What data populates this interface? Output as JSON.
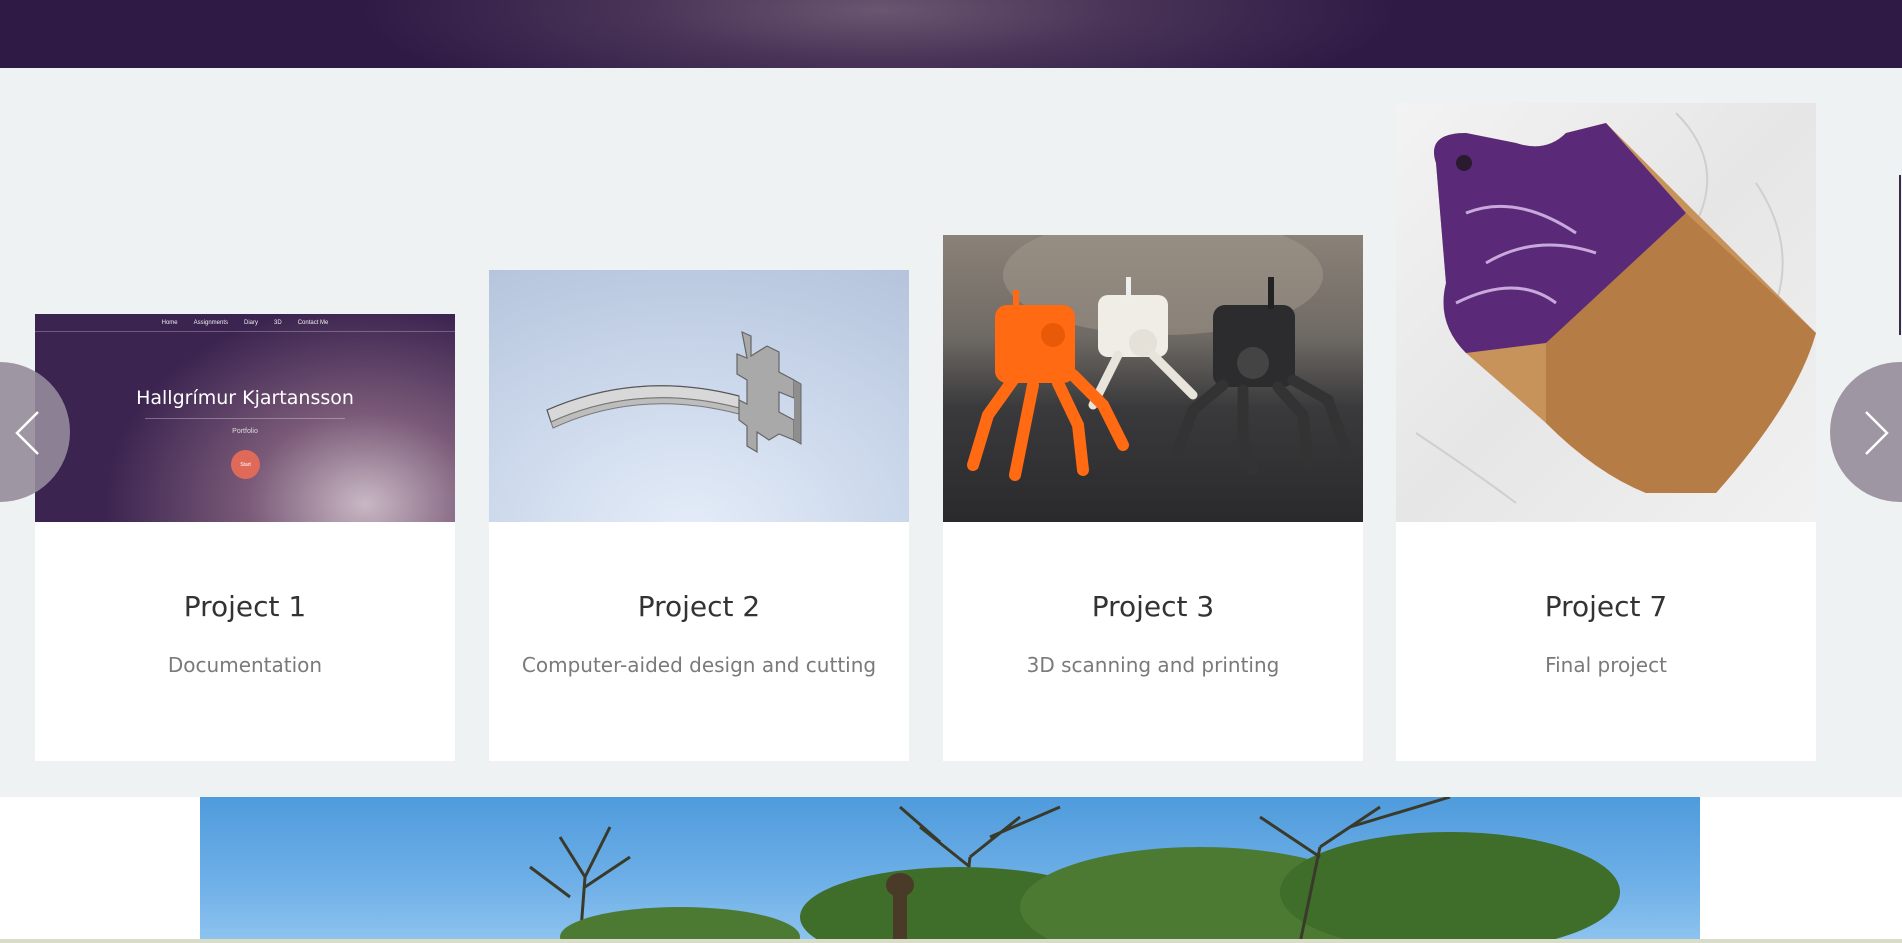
{
  "header": {
    "banner": "top-banner"
  },
  "slider": {
    "prev_icon": "chevron-left-icon",
    "next_icon": "chevron-right-icon",
    "cards": [
      {
        "title": "Project 1",
        "subtitle": "Documentation",
        "thumb": {
          "nav_items": [
            "Home",
            "Assignments",
            "Diary",
            "3D",
            "Contact Me"
          ],
          "heading": "Hallgrímur Kjartansson",
          "tagline": "Portfolio",
          "button_label": "Start"
        }
      },
      {
        "title": "Project 2",
        "subtitle": "Computer-aided design and cutting"
      },
      {
        "title": "Project 3",
        "subtitle": "3D scanning and printing"
      },
      {
        "title": "Project 7",
        "subtitle": "Final project"
      }
    ]
  },
  "colors": {
    "banner": "#3b2450",
    "background": "#eff2f3",
    "card": "#ffffff",
    "arrow": "#968c9b"
  }
}
